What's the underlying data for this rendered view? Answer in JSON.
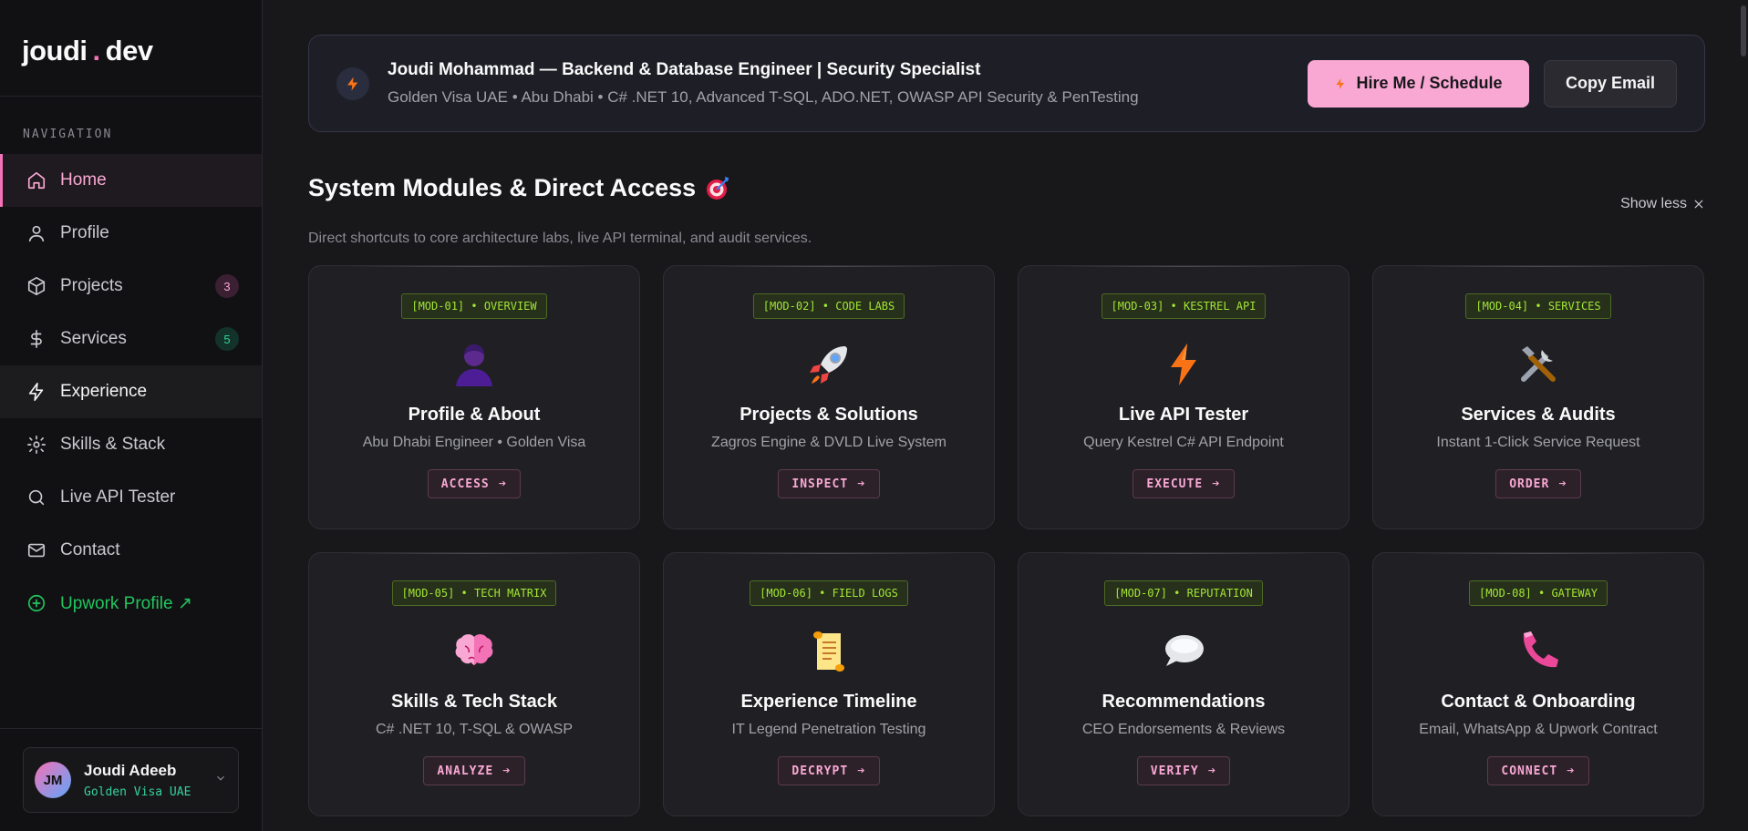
{
  "logo": {
    "first": "joudi",
    "dot": ".",
    "second": "dev"
  },
  "nav": {
    "title": "NAVIGATION",
    "items": [
      {
        "label": "Home",
        "icon": "home-icon"
      },
      {
        "label": "Profile",
        "icon": "user-icon"
      },
      {
        "label": "Projects",
        "icon": "box-icon",
        "badge": "3"
      },
      {
        "label": "Services",
        "icon": "dollar-icon",
        "badge": "5"
      },
      {
        "label": "Experience",
        "icon": "bolt-icon"
      },
      {
        "label": "Skills & Stack",
        "icon": "gear-icon"
      },
      {
        "label": "Live API Tester",
        "icon": "search-icon"
      },
      {
        "label": "Contact",
        "icon": "mail-icon"
      },
      {
        "label": "Upwork Profile ↗",
        "icon": "plus-circle-icon"
      }
    ]
  },
  "user": {
    "initials": "JM",
    "name": "Joudi Adeeb",
    "subtitle": "Golden Visa UAE"
  },
  "hero": {
    "title": "Joudi Mohammad — Backend & Database Engineer | Security Specialist",
    "subtitle": "Golden Visa UAE • Abu Dhabi • C# .NET 10, Advanced T-SQL, ADO.NET, OWASP API Security & PenTesting",
    "hire_label": "Hire Me / Schedule",
    "copy_label": "Copy Email"
  },
  "section": {
    "title": "System Modules & Direct Access",
    "subtitle": "Direct shortcuts to core architecture labs, live API terminal, and audit services.",
    "show_less": "Show less"
  },
  "modules": [
    {
      "tag": "[MOD-01] • OVERVIEW",
      "icon": "person-icon",
      "title": "Profile & About",
      "subtitle": "Abu Dhabi Engineer • Golden Visa",
      "action": "ACCESS"
    },
    {
      "tag": "[MOD-02] • CODE LABS",
      "icon": "rocket-icon",
      "title": "Projects & Solutions",
      "subtitle": "Zagros Engine & DVLD Live System",
      "action": "INSPECT"
    },
    {
      "tag": "[MOD-03] • KESTREL API",
      "icon": "lightning-icon",
      "title": "Live API Tester",
      "subtitle": "Query Kestrel C# API Endpoint",
      "action": "EXECUTE"
    },
    {
      "tag": "[MOD-04] • SERVICES",
      "icon": "tools-icon",
      "title": "Services & Audits",
      "subtitle": "Instant 1-Click Service Request",
      "action": "ORDER"
    },
    {
      "tag": "[MOD-05] • TECH MATRIX",
      "icon": "brain-icon",
      "title": "Skills & Tech Stack",
      "subtitle": "C# .NET 10, T-SQL & OWASP",
      "action": "ANALYZE"
    },
    {
      "tag": "[MOD-06] • FIELD LOGS",
      "icon": "scroll-icon",
      "title": "Experience Timeline",
      "subtitle": "IT Legend Penetration Testing",
      "action": "DECRYPT"
    },
    {
      "tag": "[MOD-07] • REPUTATION",
      "icon": "speech-bubble-icon",
      "title": "Recommendations",
      "subtitle": "CEO Endorsements & Reviews",
      "action": "VERIFY"
    },
    {
      "tag": "[MOD-08] • GATEWAY",
      "icon": "phone-icon",
      "title": "Contact & Onboarding",
      "subtitle": "Email, WhatsApp & Upwork Contract",
      "action": "CONNECT"
    }
  ],
  "colors": {
    "accent": "#f472b6",
    "accent_light": "#f9a8d4",
    "tag_green": "#a3e635",
    "success": "#22c55e"
  }
}
